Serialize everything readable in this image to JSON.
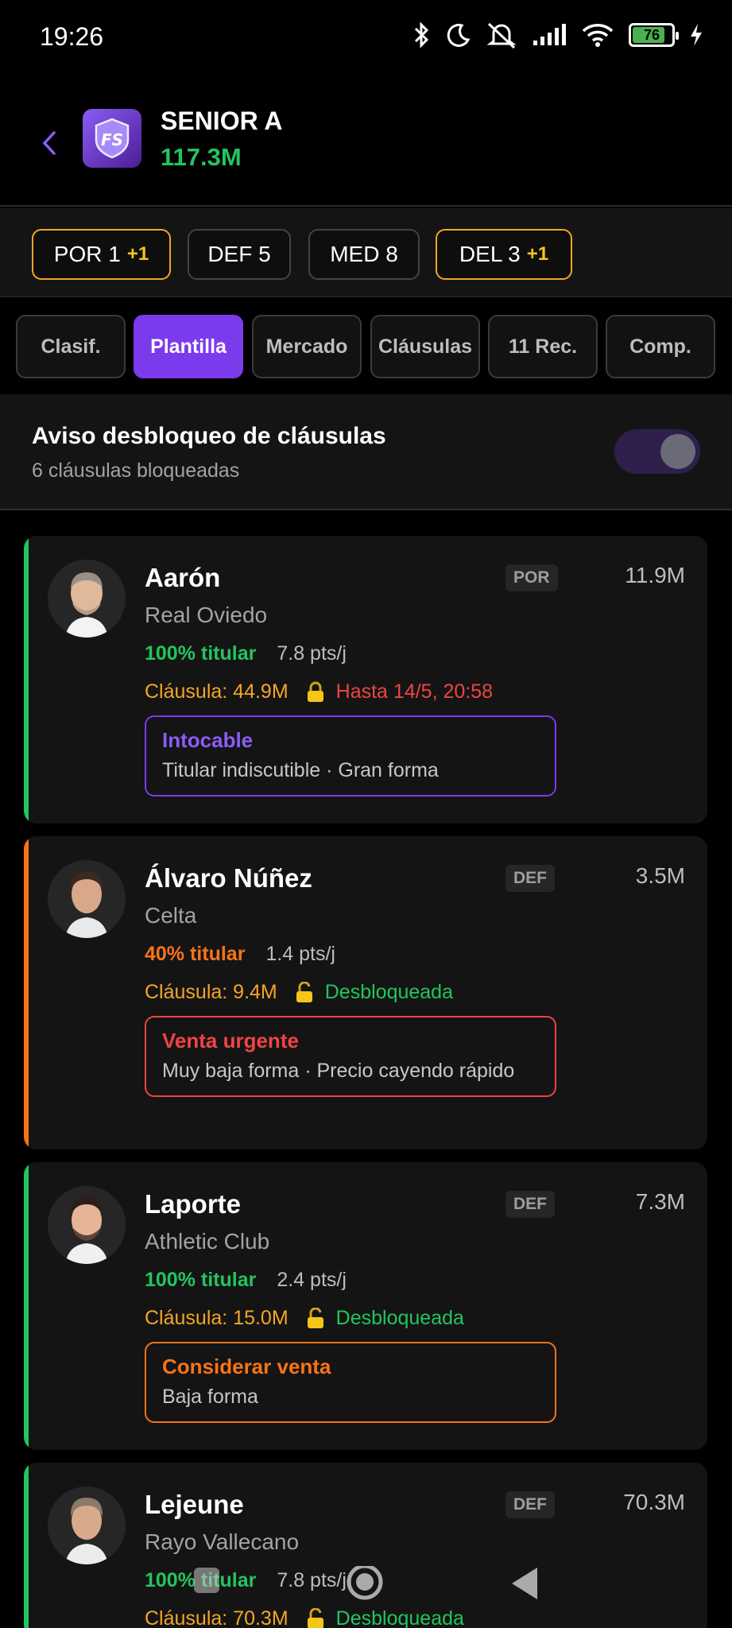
{
  "status_bar": {
    "time": "19:26",
    "battery": "76",
    "battery_level": 0.76,
    "icons": [
      "bluetooth-icon",
      "moon-icon",
      "bell-off-icon",
      "signal-icon",
      "wifi-icon",
      "battery-icon",
      "charging-icon"
    ]
  },
  "header": {
    "team_name": "SENIOR A",
    "team_value": "117.3M",
    "logo_text": "FS"
  },
  "position_chips": [
    {
      "label": "POR 1",
      "extra": "+1"
    },
    {
      "label": "DEF 5",
      "extra": ""
    },
    {
      "label": "MED 8",
      "extra": ""
    },
    {
      "label": "DEL 3",
      "extra": "+1"
    }
  ],
  "tabs": [
    {
      "label": "Clasif."
    },
    {
      "label": "Plantilla"
    },
    {
      "label": "Mercado"
    },
    {
      "label": "Cláusulas"
    },
    {
      "label": "11 Rec."
    },
    {
      "label": "Comp."
    }
  ],
  "notice": {
    "title": "Aviso desbloqueo de cláusulas",
    "subtitle": "6 cláusulas bloqueadas",
    "toggle_on": false
  },
  "players": [
    {
      "name": "Aarón",
      "club": "Real Oviedo",
      "position": "POR",
      "value": "11.9M",
      "starter": "100% titular",
      "pts": "7.8 pts/j",
      "clause": "Cláusula: 44.9M",
      "clause_status": "Hasta 14/5, 20:58",
      "advice_title": "Intocable",
      "advice_desc": "Titular indiscutible · Gran forma"
    },
    {
      "name": "Álvaro Núñez",
      "club": "Celta",
      "position": "DEF",
      "value": "3.5M",
      "starter": "40% titular",
      "pts": "1.4 pts/j",
      "clause": "Cláusula: 9.4M",
      "clause_status": "Desbloqueada",
      "advice_title": "Venta urgente",
      "advice_desc": "Muy baja forma · Precio cayendo rápido"
    },
    {
      "name": "Laporte",
      "club": "Athletic Club",
      "position": "DEF",
      "value": "7.3M",
      "starter": "100% titular",
      "pts": "2.4 pts/j",
      "clause": "Cláusula: 15.0M",
      "clause_status": "Desbloqueada",
      "advice_title": "Considerar venta",
      "advice_desc": "Baja forma"
    },
    {
      "name": "Lejeune",
      "club": "Rayo Vallecano",
      "position": "DEF",
      "value": "70.3M",
      "starter": "100% titular",
      "pts": "7.8 pts/j",
      "clause": "Cláusula: 70.3M",
      "clause_status": "Desbloqueada"
    }
  ],
  "colors": {
    "accent_purple": "#7c3aed",
    "green": "#22c55e",
    "orange": "#f97316",
    "red": "#ef4444",
    "amber": "#f5a524"
  }
}
